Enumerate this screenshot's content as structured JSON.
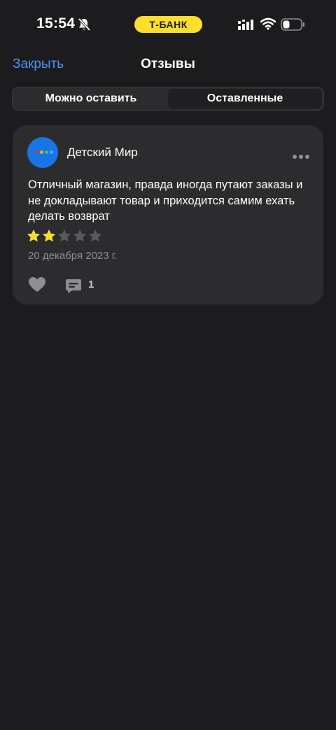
{
  "status_bar": {
    "time": "15:54",
    "bank_label": "Т‑БАНК",
    "bank_color": "#ffdd2d"
  },
  "nav": {
    "close_label": "Закрыть",
    "title": "Отзывы",
    "accent_color": "#4f8ff0"
  },
  "tabs": [
    {
      "label": "Можно оставить",
      "active": false
    },
    {
      "label": "Оставленные",
      "active": true
    }
  ],
  "review": {
    "shop_name": "Детский Мир",
    "logo_icon": "detsky-mir-logo",
    "text": "Отличный магазин, правда иногда путают заказы и не докладывают товар и приходится самим ехать делать возврат",
    "rating": 2,
    "rating_max": 5,
    "date": "20 декабря 2023 г.",
    "comment_count": "1",
    "star_color": "#ffdd2d"
  }
}
